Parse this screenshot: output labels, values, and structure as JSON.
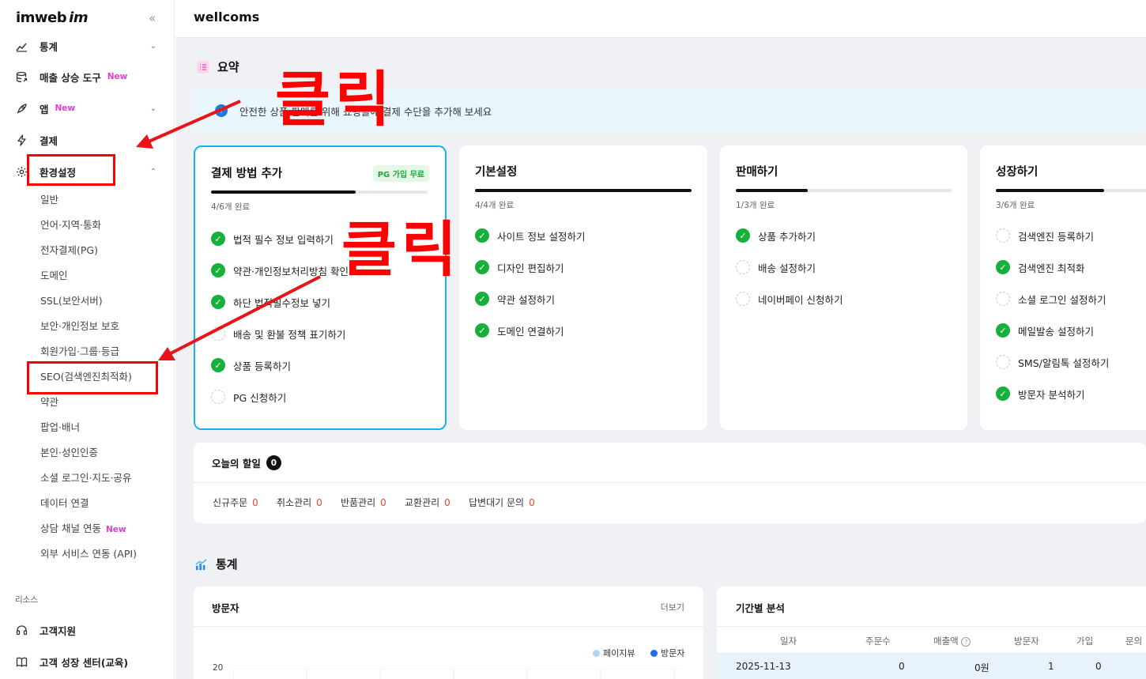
{
  "sidebar": {
    "logo": "imweb",
    "logo_mark": "im",
    "collapse_icon": "«",
    "top_partial": "통계",
    "items": [
      {
        "label": "매출 상승 도구",
        "badge": "New"
      },
      {
        "label": "앱",
        "badge": "New"
      },
      {
        "label": "결제"
      },
      {
        "label": "환경설정"
      }
    ],
    "sub_items": [
      {
        "label": "일반"
      },
      {
        "label": "언어·지역·통화"
      },
      {
        "label": "전자결제(PG)"
      },
      {
        "label": "도메인"
      },
      {
        "label": "SSL(보안서버)"
      },
      {
        "label": "보안·개인정보 보호"
      },
      {
        "label": "회원가입·그룹·등급"
      },
      {
        "label": "SEO(검색엔진최적화)"
      },
      {
        "label": "약관"
      },
      {
        "label": "팝업·배너"
      },
      {
        "label": "본인·성인인증"
      },
      {
        "label": "소셜 로그인·지도·공유"
      },
      {
        "label": "데이터 연결"
      },
      {
        "label": "상담 채널 연동",
        "badge": "New"
      },
      {
        "label": "외부 서비스 연동 (API)"
      }
    ],
    "resources_label": "리소스",
    "resources": [
      {
        "label": "고객지원"
      },
      {
        "label": "고객 성장 센터(교육)"
      }
    ]
  },
  "header": {
    "site_name": "wellcoms"
  },
  "summary": {
    "title": "요약",
    "notice": "안전한 상품 판매를 위해 쇼핑몰에 결제 수단을 추가해 보세요",
    "cards": [
      {
        "title": "결제 방법 추가",
        "badge": "PG 가입 무료",
        "progress_text": "4/6개 완료",
        "progress": 0.667,
        "tasks": [
          {
            "label": "법적 필수 정보 입력하기",
            "done": true
          },
          {
            "label": "약관·개인정보처리방침 확인",
            "done": true
          },
          {
            "label": "하단 법적필수정보 넣기",
            "done": true
          },
          {
            "label": "배송 및 환불 정책 표기하기",
            "done": false
          },
          {
            "label": "상품 등록하기",
            "done": true
          },
          {
            "label": "PG 신청하기",
            "done": false
          }
        ]
      },
      {
        "title": "기본설정",
        "progress_text": "4/4개 완료",
        "progress": 1.0,
        "tasks": [
          {
            "label": "사이트 정보 설정하기",
            "done": true
          },
          {
            "label": "디자인 편집하기",
            "done": true
          },
          {
            "label": "약관 설정하기",
            "done": true
          },
          {
            "label": "도메인 연결하기",
            "done": true
          }
        ]
      },
      {
        "title": "판매하기",
        "progress_text": "1/3개 완료",
        "progress": 0.333,
        "tasks": [
          {
            "label": "상품 추가하기",
            "done": true
          },
          {
            "label": "배송 설정하기",
            "done": false
          },
          {
            "label": "네이버페이 신청하기",
            "done": false
          }
        ]
      },
      {
        "title": "성장하기",
        "progress_text": "3/6개 완료",
        "progress": 0.5,
        "tasks": [
          {
            "label": "검색엔진 등록하기",
            "done": false
          },
          {
            "label": "검색엔진 최적화",
            "done": true
          },
          {
            "label": "소셜 로그인 설정하기",
            "done": false
          },
          {
            "label": "메일발송 설정하기",
            "done": true
          },
          {
            "label": "SMS/알림톡 설정하기",
            "done": false
          },
          {
            "label": "방문자 분석하기",
            "done": true
          }
        ]
      }
    ]
  },
  "todo": {
    "title": "오늘의 할일",
    "count": "0",
    "items": [
      {
        "label": "신규주문",
        "value": "0"
      },
      {
        "label": "취소관리",
        "value": "0"
      },
      {
        "label": "반품관리",
        "value": "0"
      },
      {
        "label": "교환관리",
        "value": "0"
      },
      {
        "label": "답변대기 문의",
        "value": "0"
      }
    ]
  },
  "stats": {
    "title": "통계",
    "visitors": {
      "title": "방문자",
      "more": "더보기",
      "legend": [
        {
          "label": "페이지뷰",
          "color": "#a8d8f5"
        },
        {
          "label": "방문자",
          "color": "#1f6fe8"
        }
      ],
      "y_tick": "20"
    },
    "period": {
      "title": "기간별 분석",
      "headers": [
        "일자",
        "주문수",
        "매출액",
        "방문자",
        "가입",
        "문의"
      ],
      "help_icon": "?",
      "row": [
        "2025-11-13",
        "0",
        "0원",
        "1",
        "0"
      ]
    }
  },
  "annotations": {
    "click_label_1": "클릭",
    "click_label_2": "클릭",
    "color": "#ff0000"
  }
}
